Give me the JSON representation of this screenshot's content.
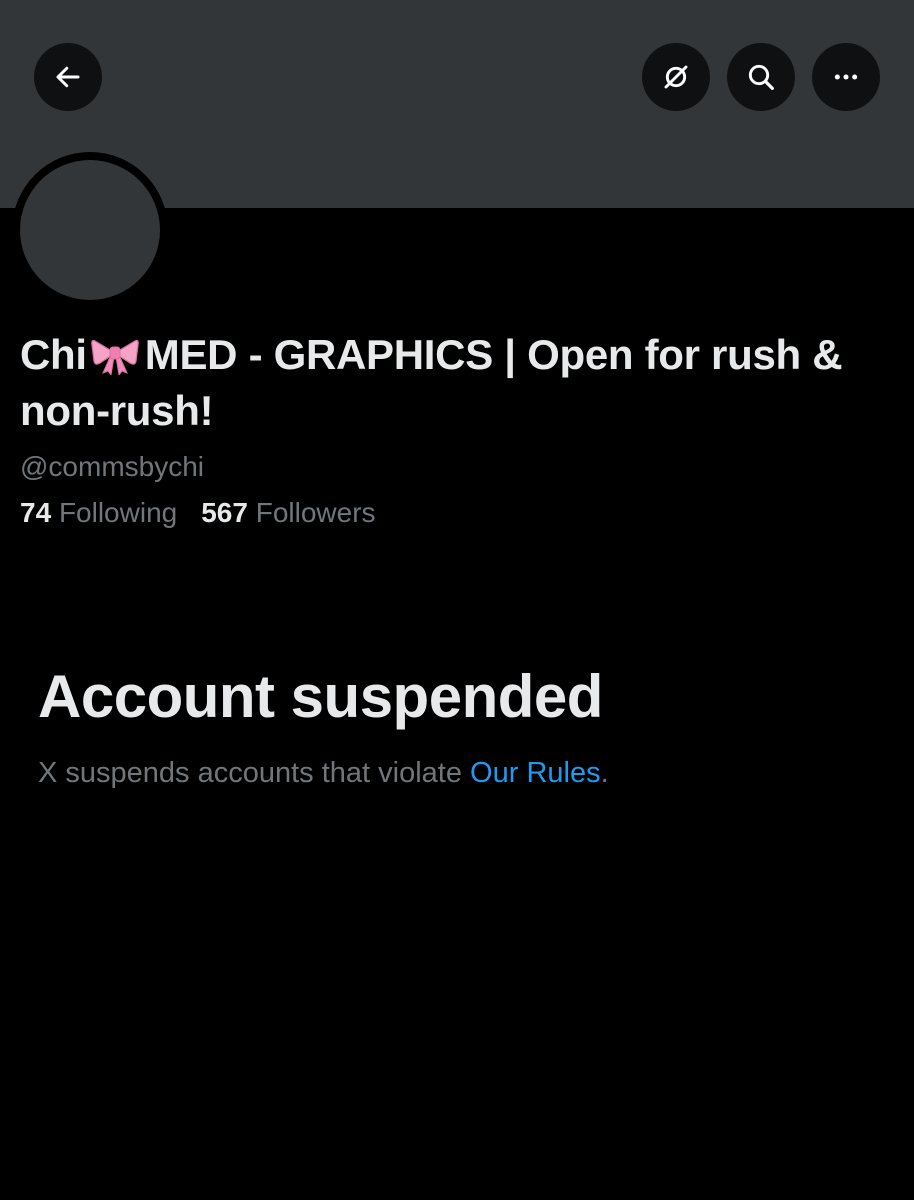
{
  "profile": {
    "name_part1": "Chi",
    "name_emoji": "bow-emoji",
    "name_part2": "MED - GRAPHICS | Open for rush & non-rush!",
    "handle": "@commsbychi",
    "following_count": "74",
    "following_label": "Following",
    "followers_count": "567",
    "followers_label": "Followers"
  },
  "nav": {
    "back_icon": "arrow-left-icon",
    "translate_icon": "translate-off-icon",
    "search_icon": "search-icon",
    "more_icon": "more-horizontal-icon"
  },
  "suspension": {
    "title": "Account suspended",
    "description": "X suspends accounts that violate",
    "link_text": "Our Rules",
    "trailing": "."
  },
  "colors": {
    "background": "#000000",
    "banner": "#333639",
    "primary_text": "#e7e9ea",
    "secondary_text": "#71767b",
    "link": "#1d9bf0"
  }
}
